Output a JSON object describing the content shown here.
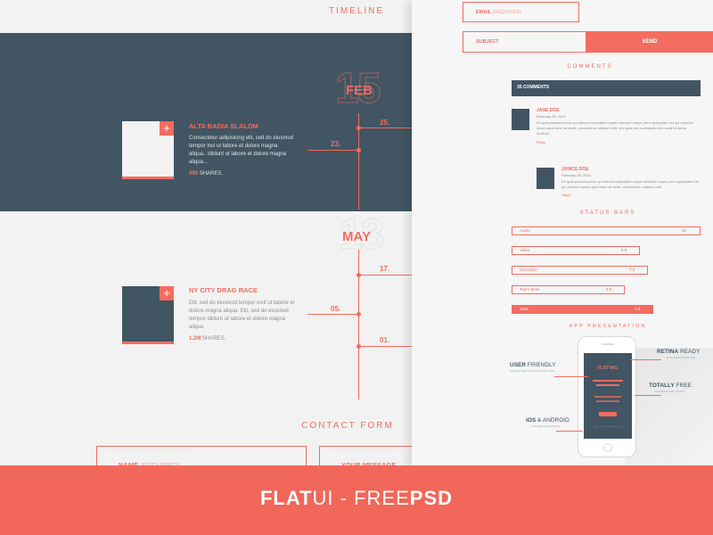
{
  "timeline": {
    "title": "TIMELINE",
    "months": [
      {
        "big": "15",
        "name": "FEB"
      },
      {
        "big": "13",
        "name": "MAY"
      }
    ],
    "days": [
      "25.",
      "23.",
      "17.",
      "05.",
      "01."
    ],
    "cards": [
      {
        "title": "ALTA BADIA SLALOM",
        "text": "Consectetur adipisicing elit, sed do eiusmod tempor inci ut labore et dolore magna aliqua.. Ididunt ut labore et dolore magna aliqua...",
        "shares_num": "999",
        "shares_label": "SHARES.",
        "plus": "+"
      },
      {
        "title": "NY CITY DRAG RACE",
        "text": "Elit, sed do eiusmod tempor incit ut labore et dolore magna aliqua. Elit, sed do eiusmod tempor ididunt ut labore et dolore magna aliqua.",
        "shares_num": "1.2M",
        "shares_label": "SHARES.",
        "plus": "+"
      }
    ]
  },
  "contact": {
    "title": "CONTACT FORM",
    "name_label": "NAME",
    "name_hint": "(REQUIRED)",
    "message_label": "YOUR MESSAGE",
    "email_label": "EMAIL",
    "email_hint": "(REQUIRED)",
    "subject_label": "SUBJECT",
    "send_label": "SEND"
  },
  "comments": {
    "title": "COMMENTS",
    "header": "35 COMMENTS",
    "items": [
      {
        "name": "JANE DOE",
        "date": "February 28, 2014",
        "text": "Ed quia possimus eos qui ratione voluptatem sequi nesciunt neque porro quisquam est qui dolorem ipsum quia dolor sit amet, consectetur adipisci velit, sed quia non numquam eius modi tempora incidunt.",
        "reply": "Reply"
      },
      {
        "name": "JANICE DOE",
        "date": "February 28, 2014",
        "text": "Ed quia possimus eos qui ratione voluptatem sequi nesciunt neque porro quisquam est qui dolorem ipsum quia dolor sit amet, consectetur adipisci velit.",
        "reply": "Reply"
      }
    ]
  },
  "status_bars": {
    "title": "STATUS BARS",
    "bars": [
      {
        "label": "Audio",
        "value": "10",
        "level": 1.0
      },
      {
        "label": "Video",
        "value": "6.8",
        "level": 0.68
      },
      {
        "label": "Execution",
        "value": "7.2",
        "level": 0.72
      },
      {
        "label": "Team Work",
        "value": "6.0",
        "level": 0.6
      },
      {
        "label": "Total",
        "value": "7.5",
        "level": 0.75
      }
    ]
  },
  "app": {
    "title": "APP PRESENTATION",
    "screen_brand": "FLATVAG",
    "screen_button": "",
    "features": [
      {
        "bold": "USER",
        "rest": " FRIENDLY",
        "sub": "EASIEST APP FOR ANDROID & IOS"
      },
      {
        "bold": "RETINA",
        "rest": " READY",
        "sub": "HIGH DEFINITION APP"
      },
      {
        "bold": "TOTALLY",
        "rest": " FREE",
        "sub": "NO ADDITIONAL COSTS"
      },
      {
        "bold": "iOS",
        "rest": " & ANDROID",
        "sub": "AVAILABLE FOR BOTH"
      }
    ]
  },
  "banner": {
    "bold1": "FLAT",
    "text1": "UI - FREE",
    "bold2": "PSD"
  },
  "colors": {
    "accent": "#f36c5f",
    "dark": "#415563",
    "bg": "#f4f4f4"
  }
}
